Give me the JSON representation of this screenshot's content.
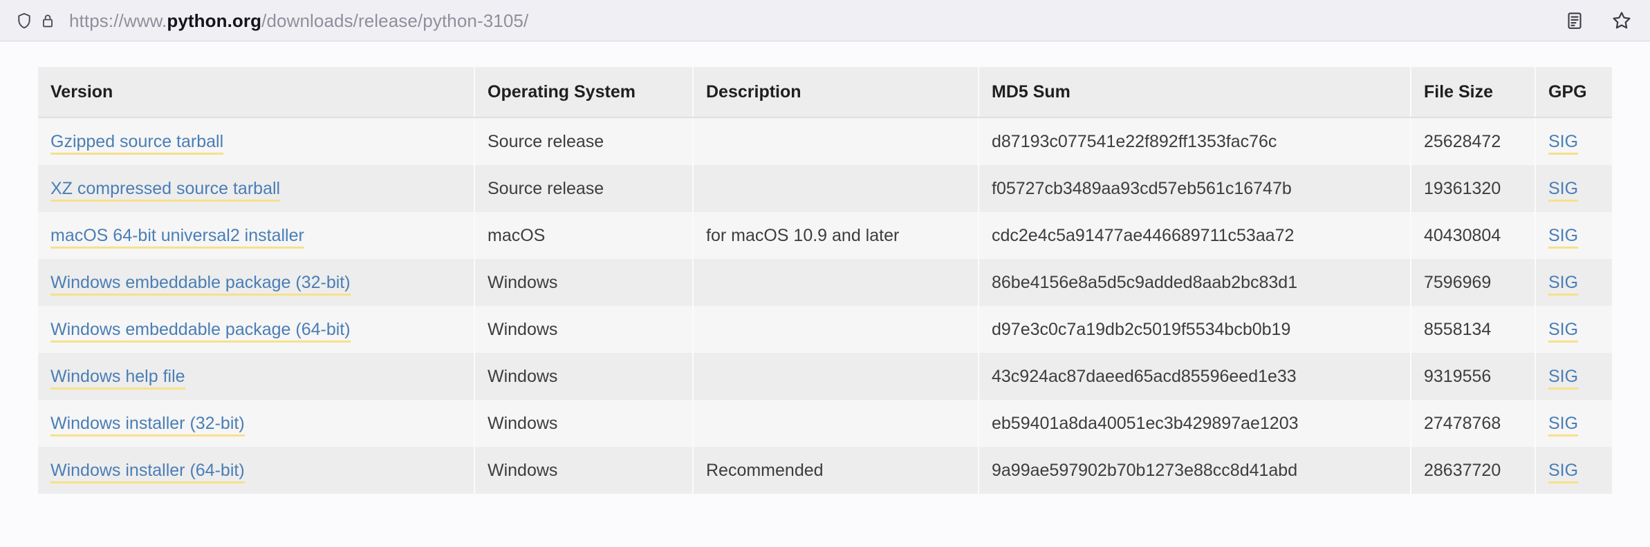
{
  "browser": {
    "url_prefix": "https://www.",
    "url_host": "python.org",
    "url_suffix": "/downloads/release/python-3105/",
    "url_full": "https://www.python.org/downloads/release/python-3105/",
    "icons": {
      "shield": "shield-icon",
      "lock": "lock-icon",
      "reader": "reader-mode-icon",
      "bookmark": "bookmark-star-icon"
    }
  },
  "table": {
    "columns": [
      "Version",
      "Operating System",
      "Description",
      "MD5 Sum",
      "File Size",
      "GPG"
    ],
    "sig_label": "SIG",
    "rows": [
      {
        "version": "Gzipped source tarball",
        "os": "Source release",
        "description": "",
        "md5": "d87193c077541e22f892ff1353fac76c",
        "size": "25628472",
        "gpg": "SIG"
      },
      {
        "version": "XZ compressed source tarball",
        "os": "Source release",
        "description": "",
        "md5": "f05727cb3489aa93cd57eb561c16747b",
        "size": "19361320",
        "gpg": "SIG"
      },
      {
        "version": "macOS 64-bit universal2 installer",
        "os": "macOS",
        "description": "for macOS 10.9 and later",
        "md5": "cdc2e4c5a91477ae446689711c53aa72",
        "size": "40430804",
        "gpg": "SIG"
      },
      {
        "version": "Windows embeddable package (32-bit)",
        "os": "Windows",
        "description": "",
        "md5": "86be4156e8a5d5c9added8aab2bc83d1",
        "size": "7596969",
        "gpg": "SIG"
      },
      {
        "version": "Windows embeddable package (64-bit)",
        "os": "Windows",
        "description": "",
        "md5": "d97e3c0c7a19db2c5019f5534bcb0b19",
        "size": "8558134",
        "gpg": "SIG"
      },
      {
        "version": "Windows help file",
        "os": "Windows",
        "description": "",
        "md5": "43c924ac87daeed65acd85596eed1e33",
        "size": "9319556",
        "gpg": "SIG"
      },
      {
        "version": "Windows installer (32-bit)",
        "os": "Windows",
        "description": "",
        "md5": "eb59401a8da40051ec3b429897ae1203",
        "size": "27478768",
        "gpg": "SIG"
      },
      {
        "version": "Windows installer (64-bit)",
        "os": "Windows",
        "description": "Recommended",
        "md5": "9a99ae597902b70b1273e88cc8d41abd",
        "size": "28637720",
        "gpg": "SIG"
      }
    ]
  },
  "colors": {
    "link": "#4a7eb5",
    "link_underline": "#f7e08a",
    "header_bg": "#ededed",
    "row_odd": "#f6f6f6",
    "row_even": "#ededed",
    "page_bg": "#fbfbfd",
    "chrome_bg": "#f0f0f4"
  }
}
